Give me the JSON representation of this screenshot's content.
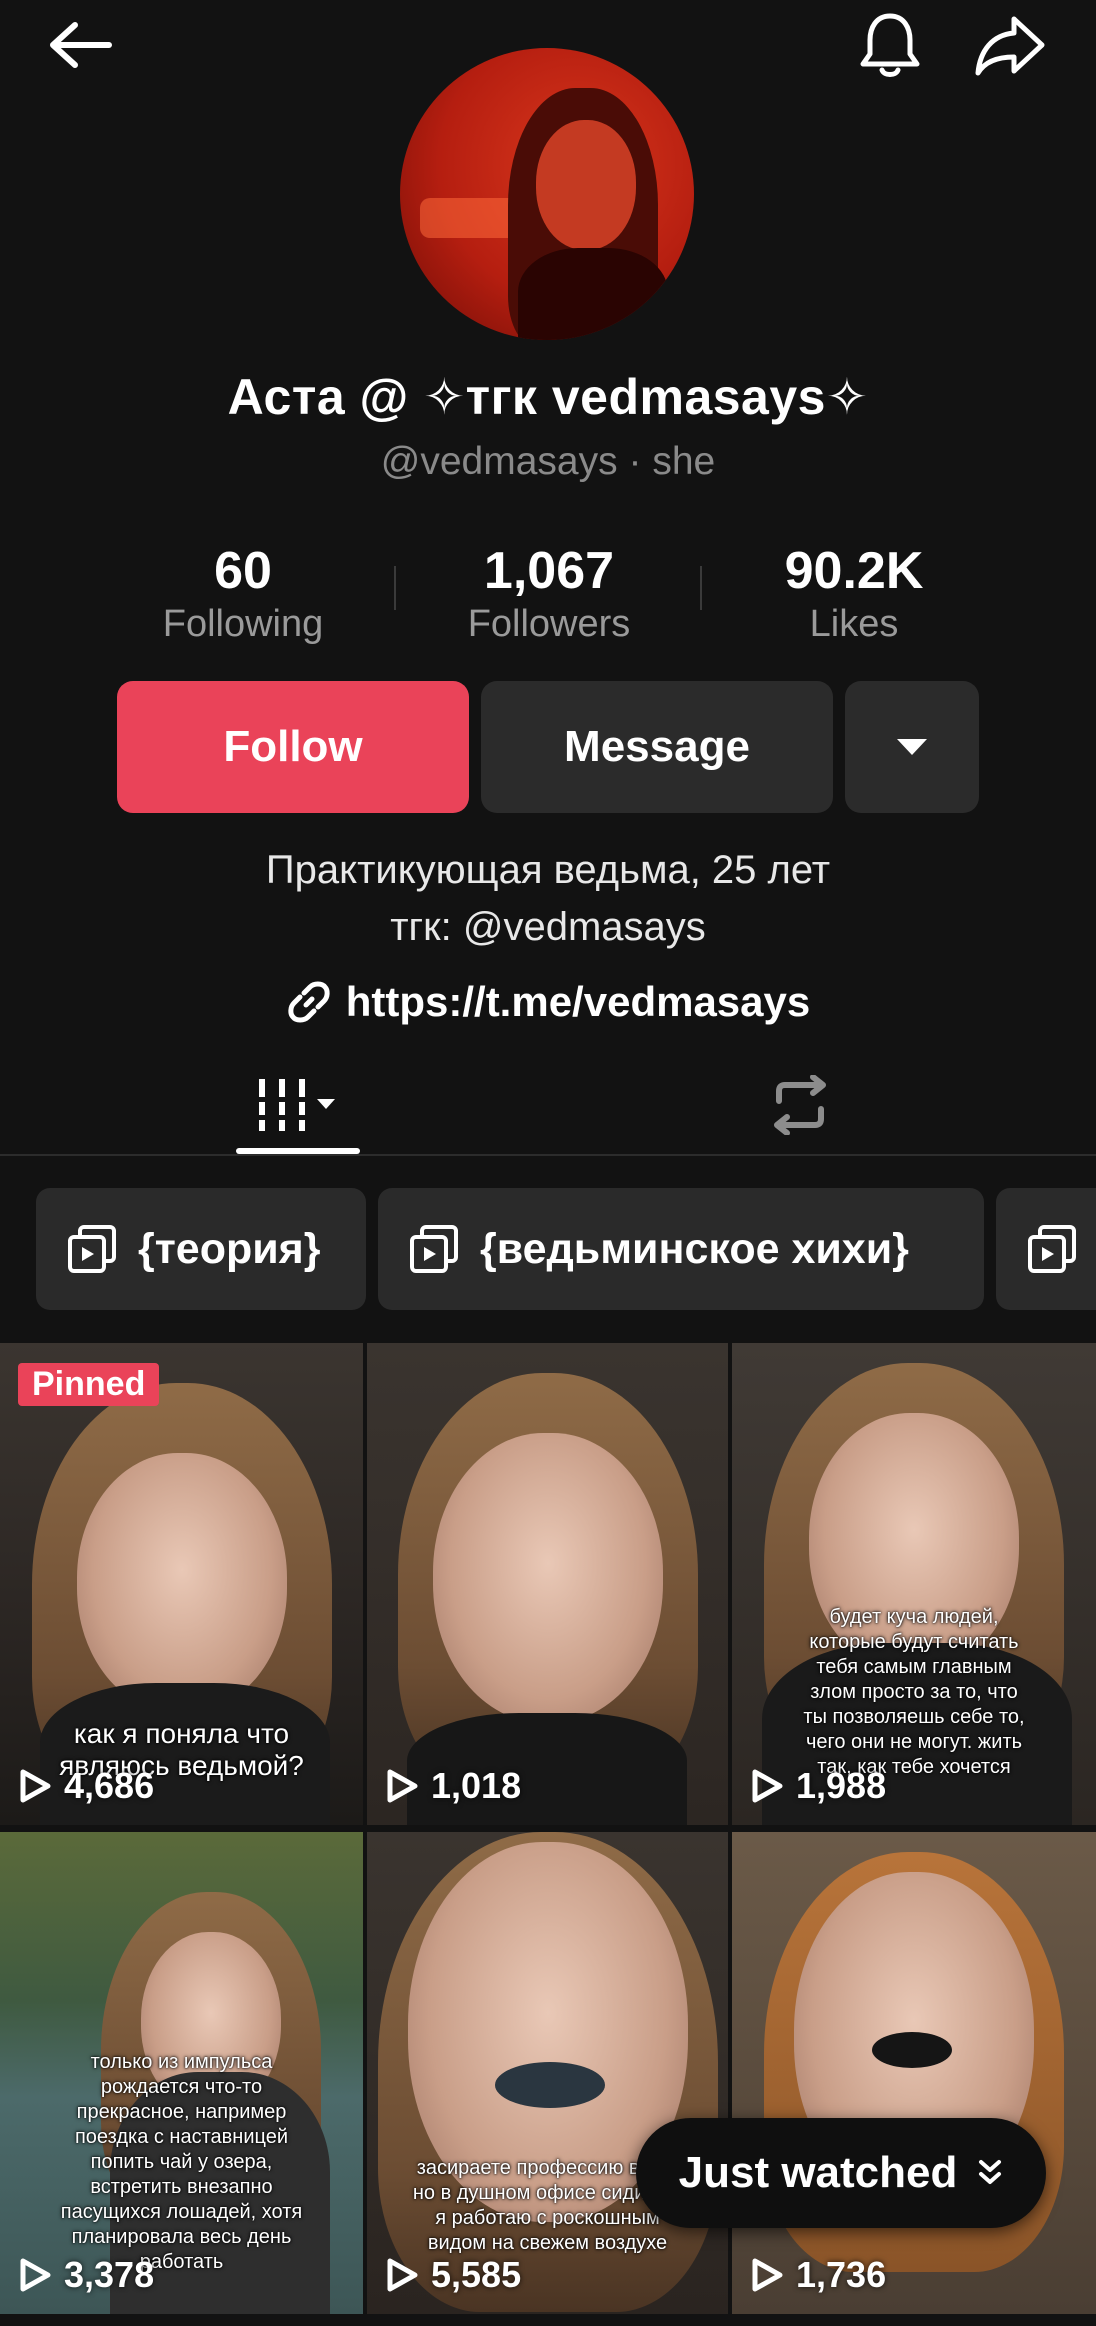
{
  "profile": {
    "display_name": "Аста @ ✧тгк vedmasays✧",
    "handle": "@vedmasays",
    "pronouns": "she",
    "separator": "·",
    "bio_line1": "Практикующая ведьма, 25 лет",
    "bio_line2": "тгк: @vedmasays",
    "link": "https://t.me/vedmasays"
  },
  "stats": [
    {
      "value": "60",
      "label": "Following"
    },
    {
      "value": "1,067",
      "label": "Followers"
    },
    {
      "value": "90.2K",
      "label": "Likes"
    }
  ],
  "actions": {
    "follow": "Follow",
    "message": "Message"
  },
  "playlists": [
    {
      "label": "{теория}"
    },
    {
      "label": "{ведьминское хихи}"
    },
    {
      "label": ""
    }
  ],
  "videos": [
    {
      "views": "4,686",
      "pinned": "Pinned",
      "caption": "как я поняла что являюсь ведьмой?"
    },
    {
      "views": "1,018",
      "caption": ""
    },
    {
      "views": "1,988",
      "caption": "будет куча людей, которые будут считать тебя самым главным злом просто за то, что ты позволяешь себе то, чего они не могут. жить так, как тебе хочется"
    },
    {
      "views": "3,378",
      "caption": "только из импульса рождается что-то прекрасное, например поездка с наставницей попить чай у озера, встретить внезапно пасущихся лошадей, хотя планировала весь день работать"
    },
    {
      "views": "5,585",
      "caption": "засираете профессию вед... но в душном офисе сидите а я работаю с роскошным видом на свежем воздухе"
    },
    {
      "views": "1,736",
      "caption": ""
    }
  ],
  "just_watched": "Just watched",
  "colors": {
    "accent": "#ea4359",
    "background": "#121212",
    "button_dark": "#2b2b2b"
  },
  "icons": [
    "back-arrow-icon",
    "bell-icon",
    "share-icon",
    "link-icon",
    "grid-icon",
    "repost-icon",
    "playlist-icon",
    "play-icon",
    "dropdown-icon"
  ]
}
